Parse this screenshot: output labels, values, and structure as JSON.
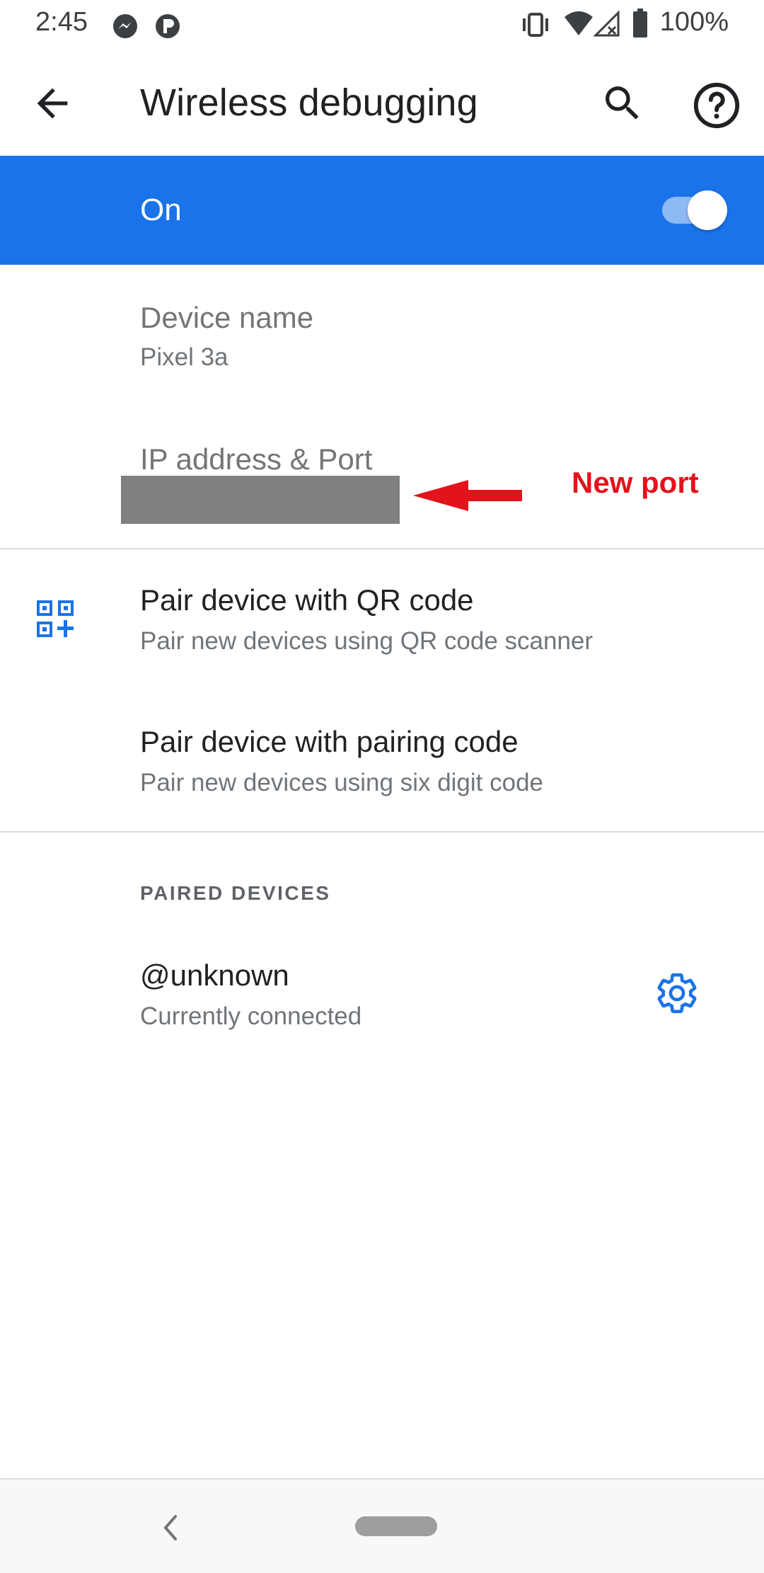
{
  "status_bar": {
    "time": "2:45",
    "battery_text": "100%",
    "icons": [
      "messenger-icon",
      "app-notification-icon",
      "vibrate-icon",
      "wifi-icon",
      "signal-no-sim-icon",
      "battery-icon"
    ]
  },
  "app_bar": {
    "title": "Wireless debugging",
    "icons": [
      "back-arrow-icon",
      "search-icon",
      "help-icon"
    ]
  },
  "main_switch": {
    "label": "On",
    "checked": true,
    "color": "#1a73e8"
  },
  "device_name": {
    "title": "Device name",
    "summary": "Pixel 3a"
  },
  "ip_address": {
    "title": "IP address & Port"
  },
  "annotation": {
    "label": "New port",
    "color": "#e3131b"
  },
  "pair_qr": {
    "title": "Pair device with QR code",
    "summary": "Pair new devices using QR code scanner",
    "icon": "qr-code-scanner-icon"
  },
  "pair_code": {
    "title": "Pair device with pairing code",
    "summary": "Pair new devices using six digit code"
  },
  "paired_devices": {
    "header": "PAIRED DEVICES",
    "items": [
      {
        "title": "@unknown",
        "summary": "Currently connected",
        "icon": "gear-icon"
      }
    ]
  },
  "nav_bar": {
    "icons": [
      "nav-back-icon",
      "nav-home-pill"
    ]
  }
}
